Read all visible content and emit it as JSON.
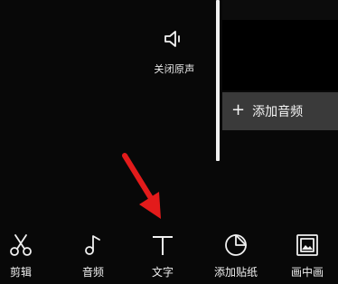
{
  "timeline": {
    "mute_label": "关闭原声",
    "add_audio_label": "添加音频"
  },
  "toolbar": {
    "items": [
      {
        "label": "剪辑",
        "icon": "scissors-icon"
      },
      {
        "label": "音频",
        "icon": "music-note-icon"
      },
      {
        "label": "文字",
        "icon": "text-icon"
      },
      {
        "label": "添加贴纸",
        "icon": "sticker-icon"
      },
      {
        "label": "画中画",
        "icon": "picture-in-picture-icon"
      }
    ]
  },
  "colors": {
    "background": "#080808",
    "text": "#f0f0f0",
    "add_audio_bg": "#3a3a3a",
    "annotation_red": "#e31b1b"
  }
}
